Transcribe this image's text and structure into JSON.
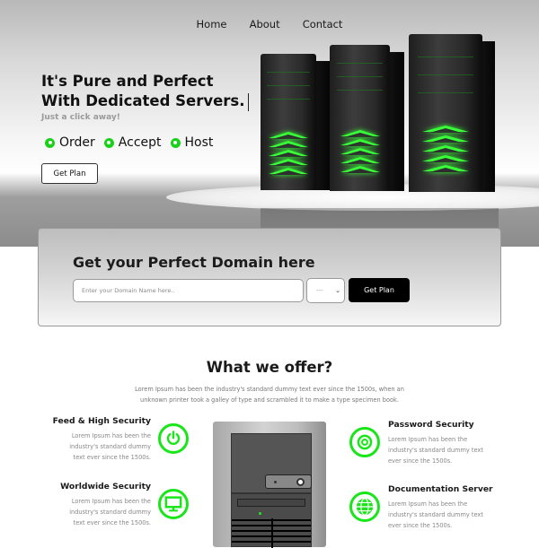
{
  "nav": {
    "items": [
      {
        "label": "Home"
      },
      {
        "label": "About"
      },
      {
        "label": "Contact"
      }
    ]
  },
  "hero": {
    "headline_line1": "It's Pure and Perfect",
    "headline_line2": "With Dedicated Servers.",
    "subline": "Just a click away!",
    "features": [
      {
        "label": "Order",
        "icon": "green-dot-icon"
      },
      {
        "label": "Accept",
        "icon": "green-dot-icon"
      },
      {
        "label": "Host",
        "icon": "green-dot-icon"
      }
    ],
    "button_label": "Get Plan",
    "image": "server-towers-illustration"
  },
  "domain": {
    "title": "Get your Perfect Domain here",
    "input_placeholder": "Enter your Domain Name here..",
    "input_value": "",
    "select_value": "---",
    "button_label": "Get Plan"
  },
  "offer": {
    "title": "What we offer?",
    "description": "Lorem Ipsum has been the industry's standard dummy text ever since the 1500s, when an unknown printer took a galley of type and scrambled it to make a type specimen book.",
    "services": [
      {
        "title": "Feed & High Security",
        "text": "Lorem Ipsum has been the industry's standard dummy text ever since the 1500s.",
        "icon": "power-icon"
      },
      {
        "title": "Worldwide Security",
        "text": "Lorem Ipsum has been the industry's standard dummy text ever since the 1500s.",
        "icon": "monitor-icon"
      },
      {
        "title": "Password Security",
        "text": "Lorem Ipsum has been the industry's standard dummy text ever since the 1500s.",
        "icon": "target-icon"
      },
      {
        "title": "Documentation Server",
        "text": "Lorem Ipsum has been the industry's standard dummy text ever since the 1500s.",
        "icon": "globe-icon"
      }
    ],
    "image": "pc-tower-illustration"
  },
  "colors": {
    "accent_green": "#19e619",
    "button_dark": "#000000",
    "text_dark": "#1a1a1a",
    "text_muted": "#888888"
  }
}
